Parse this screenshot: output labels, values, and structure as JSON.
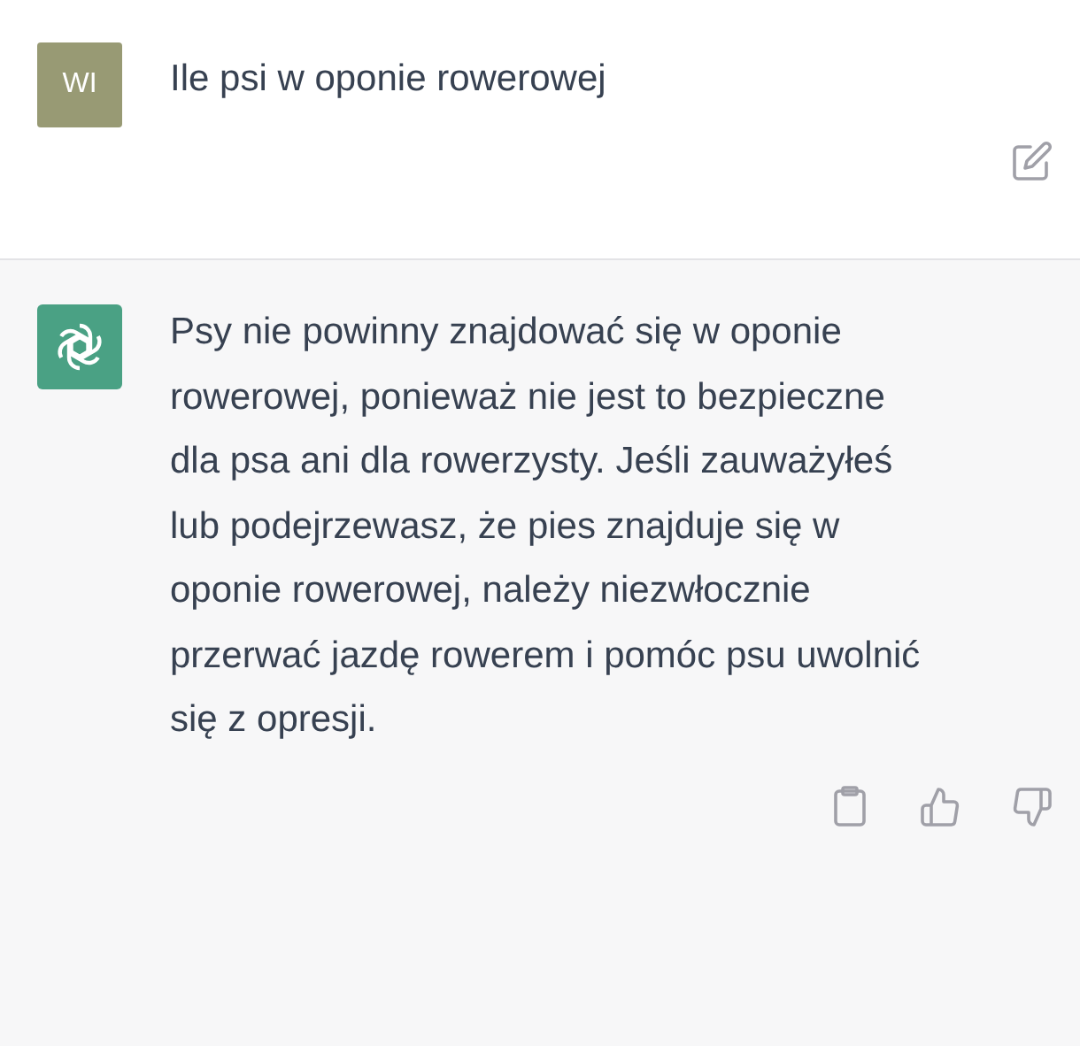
{
  "messages": [
    {
      "kind": "user",
      "avatar": "WI",
      "text": "Ile psi w oponie rowerowej"
    },
    {
      "kind": "assistant",
      "text": "Psy nie powinny znajdować się w oponie rowerowej, ponieważ nie jest to bezpieczne dla psa ani dla rowerzysty. Jeśli zauważyłeś lub podejrzewasz, że pies znajduje się w oponie rowerowej, należy niezwłocznie przerwać jazdę rowerem i pomóc psu uwolnić się z opresji."
    }
  ]
}
